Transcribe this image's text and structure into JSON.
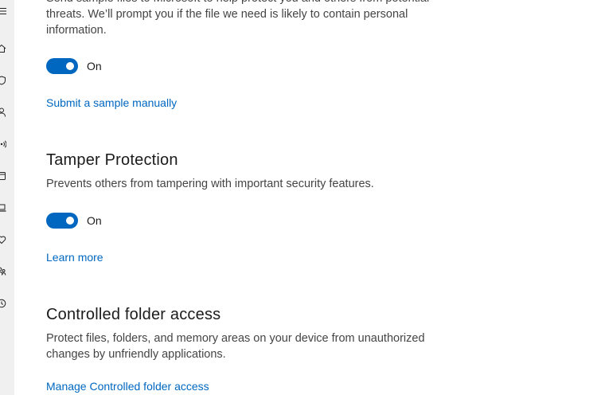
{
  "sidebar": {
    "icons": [
      "menu-icon",
      "home-icon",
      "shield-icon",
      "person-icon",
      "wifi-icon",
      "app-browser-icon",
      "laptop-icon",
      "heart-icon",
      "family-icon",
      "history-icon"
    ]
  },
  "sample_submission": {
    "description": "Send sample files to Microsoft to help protect you and others from potential threats. We’ll prompt you if the file we need is likely to contain personal information.",
    "toggle_label": "On",
    "toggle_on": true,
    "link_label": "Submit a sample manually"
  },
  "tamper_protection": {
    "title": "Tamper Protection",
    "description": "Prevents others from tampering with important security features.",
    "toggle_label": "On",
    "toggle_on": true,
    "link_label": "Learn more"
  },
  "controlled_folder_access": {
    "title": "Controlled folder access",
    "description": "Protect files, folders, and memory areas on your device from unauthorized changes by unfriendly applications.",
    "link_label": "Manage Controlled folder access"
  },
  "colors": {
    "accent": "#0067c0",
    "sidebar_bg": "#f0f0f0"
  }
}
